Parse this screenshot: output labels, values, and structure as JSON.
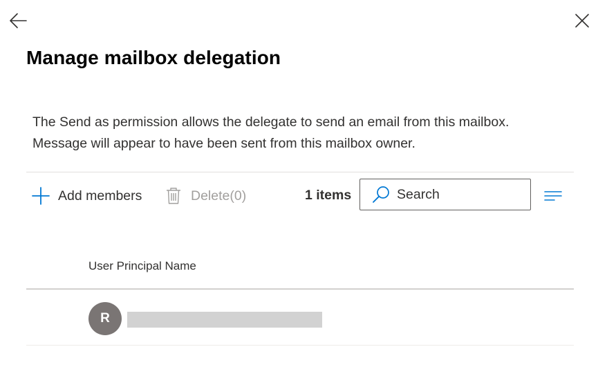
{
  "header": {
    "back_icon": "arrow-left-icon",
    "close_icon": "close-icon",
    "title": "Manage mailbox delegation"
  },
  "description": {
    "line1": "The Send as permission allows the delegate to send an email from this mailbox.",
    "line2": "Message will appear to have been sent from this mailbox owner."
  },
  "toolbar": {
    "add_label": "Add members",
    "add_icon": "plus-icon",
    "delete_label": "Delete(0)",
    "delete_icon": "trash-icon",
    "items_count": "1 items",
    "search_placeholder": "Search",
    "search_icon": "search-icon",
    "filter_icon": "filter-lines-icon"
  },
  "table": {
    "columns": [
      "User Principal Name"
    ],
    "rows": [
      {
        "avatar_initial": "R",
        "upn": ""
      }
    ]
  },
  "colors": {
    "accent": "#0078d4",
    "avatar_bg": "#7a7574",
    "disabled_text": "#a19f9d"
  }
}
